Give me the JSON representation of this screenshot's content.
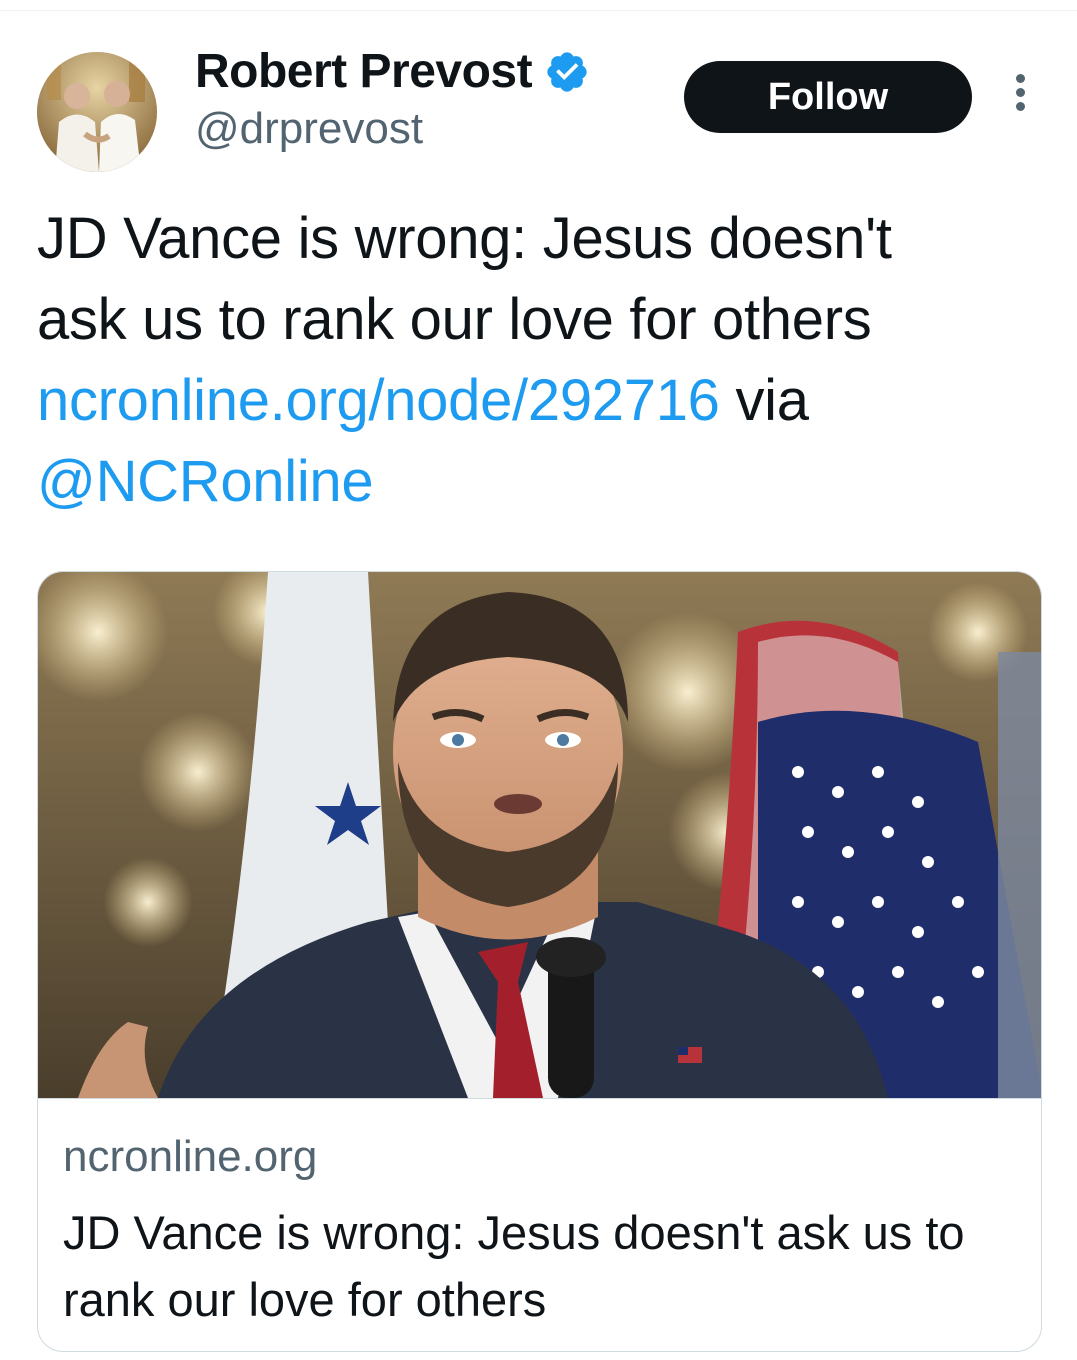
{
  "author": {
    "display_name": "Robert Prevost",
    "handle": "@drprevost",
    "verified": true,
    "verified_color": "#1d9bf0"
  },
  "actions": {
    "follow_label": "Follow",
    "more_icon": "more-vertical-icon"
  },
  "tweet": {
    "text_line1": "JD Vance is wrong: Jesus doesn't",
    "text_line2": "ask us to rank our love for others",
    "link": "ncronline.org/node/292716",
    "via": " via",
    "mention": "@NCRonline",
    "link_color": "#1d9bf0"
  },
  "card": {
    "domain": "ncronline.org",
    "title": "JD Vance is wrong: Jesus doesn't ask us to rank our love for others"
  }
}
